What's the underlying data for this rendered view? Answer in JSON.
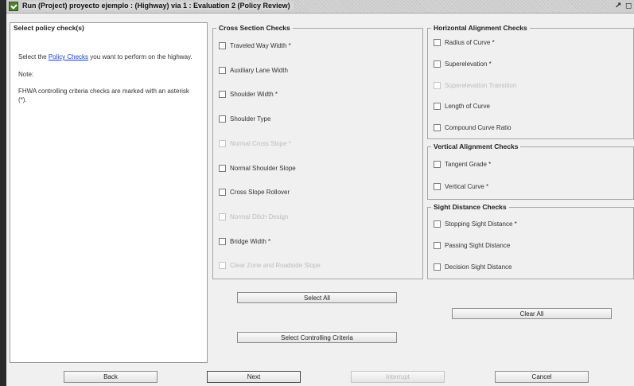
{
  "window": {
    "title": "Run (Project) proyecto ejemplo : (Highway) via 1 : Evaluation 2 (Policy Review)",
    "controls": [
      "↗",
      "◻"
    ]
  },
  "left_panel": {
    "heading": "Select policy check(s)",
    "instruction_prefix": "Select the ",
    "instruction_link": "Policy Checks",
    "instruction_suffix": " you want to perform on the highway.",
    "note": "Note:",
    "criteria_line1": "FHWA controlling criteria checks are marked with an asterisk",
    "criteria_line2": "(*)."
  },
  "cross_section": {
    "title": "Cross Section Checks",
    "items": [
      {
        "label": "Traveled Way Width *",
        "enabled": true
      },
      {
        "label": "Auxiliary Lane Width",
        "enabled": true
      },
      {
        "label": "Shoulder Width *",
        "enabled": true
      },
      {
        "label": "Shoulder Type",
        "enabled": true
      },
      {
        "label": "Normal Cross Slope *",
        "enabled": false
      },
      {
        "label": "Normal Shoulder Slope",
        "enabled": true
      },
      {
        "label": "Cross Slope Rollover",
        "enabled": true
      },
      {
        "label": "Normal Ditch Design",
        "enabled": false
      },
      {
        "label": "Bridge Width *",
        "enabled": true
      },
      {
        "label": "Clear Zone and Roadside Slope",
        "enabled": false
      }
    ]
  },
  "horizontal": {
    "title": "Horizontal Alignment Checks",
    "items": [
      {
        "label": "Radius of Curve *",
        "enabled": true
      },
      {
        "label": "Superelevation *",
        "enabled": true
      },
      {
        "label": "Superelevation Transition",
        "enabled": false
      },
      {
        "label": "Length of Curve",
        "enabled": true
      },
      {
        "label": "Compound Curve Ratio",
        "enabled": true
      }
    ]
  },
  "vertical": {
    "title": "Vertical Alignment Checks",
    "items": [
      {
        "label": "Tangent Grade *",
        "enabled": true
      },
      {
        "label": "Vertical Curve *",
        "enabled": true
      }
    ]
  },
  "sight": {
    "title": "Sight Distance Checks",
    "items": [
      {
        "label": "Stopping Sight Distance *",
        "enabled": true
      },
      {
        "label": "Passing Sight Distance",
        "enabled": true
      },
      {
        "label": "Decision Sight Distance",
        "enabled": true
      }
    ]
  },
  "buttons": {
    "select_all": "Select All",
    "clear_all": "Clear All",
    "select_controlling": "Select Controlling Criteria",
    "back": "Back",
    "next": "Next",
    "interrupt": "Interrupt",
    "cancel": "Cancel"
  }
}
